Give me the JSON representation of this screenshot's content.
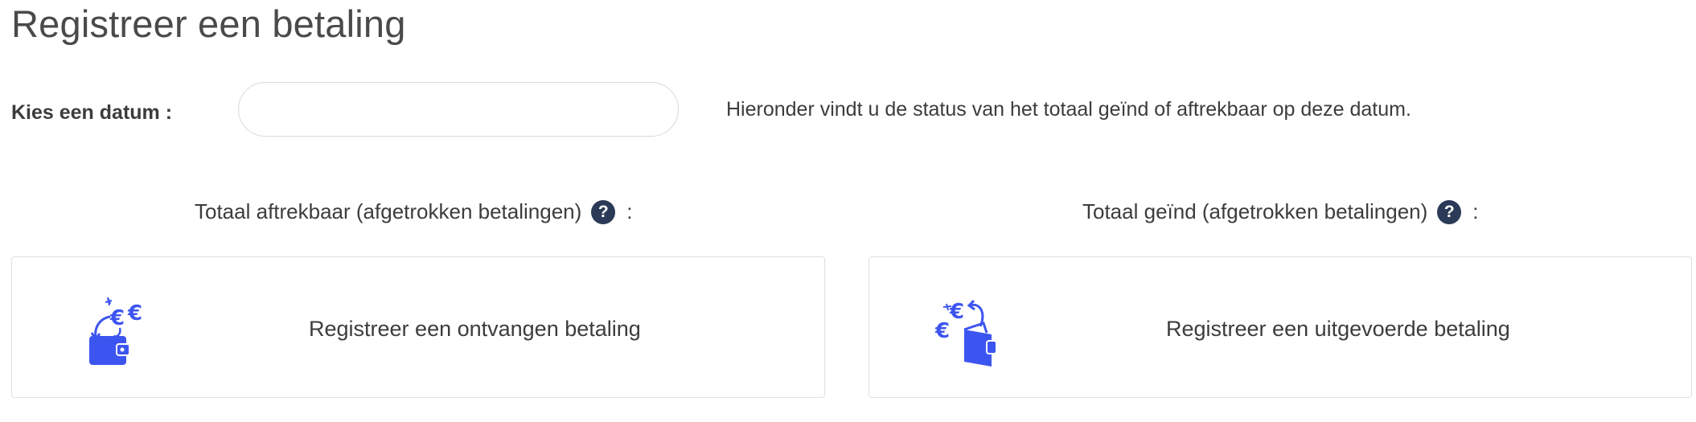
{
  "header": {
    "title": "Registreer een betaling"
  },
  "date_picker": {
    "label": "Kies een datum :",
    "value": "",
    "info": "Hieronder vindt u de status van het totaal geïnd of aftrekbaar op deze datum."
  },
  "totals": {
    "deductible_label": "Totaal aftrekbaar (afgetrokken betalingen)",
    "collected_label": "Totaal geïnd (afgetrokken betalingen)",
    "help_glyph": "?",
    "colon": ":"
  },
  "actions": {
    "received_payment": "Registreer een ontvangen betaling",
    "made_payment": "Registreer een uitgevoerde betaling"
  },
  "icons": {
    "received": "wallet-receive-euro-icon",
    "made": "wallet-send-euro-icon",
    "help": "question-circle-icon"
  },
  "colors": {
    "accent_blue": "#3d55f0",
    "help_icon_bg": "#2b3a57",
    "text": "#3c3c3c",
    "border": "#e0e0e0"
  }
}
